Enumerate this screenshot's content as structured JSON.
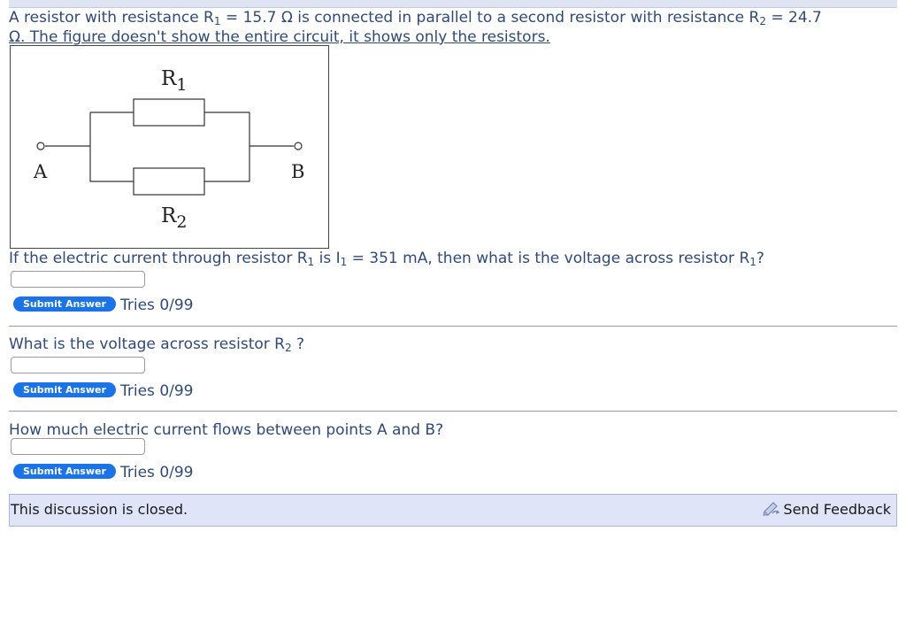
{
  "intro": {
    "p1": "A resistor with resistance R",
    "s1": "1",
    "p2": " = 15.7 Ω is connected in parallel to a second resistor with resistance R",
    "s2": "2",
    "p3": " = 24.7",
    "p4": "Ω. The figure doesn't show the entire circuit, it shows only the resistors."
  },
  "figure": {
    "label_r1": "R",
    "label_r1_sub": "1",
    "label_r2": "R",
    "label_r2_sub": "2",
    "label_a": "A",
    "label_b": "B"
  },
  "q1": {
    "p1": "If the electric current through resistor R",
    "s1": "1",
    "p2": " is I",
    "s2": "1",
    "p3": " = 351 mA, then what is the voltage across resistor R",
    "s3": "1",
    "p4": "?",
    "input_value": "",
    "submit_label": "Submit Answer",
    "tries": "Tries 0/99"
  },
  "q2": {
    "p1": "What is the voltage across resistor R",
    "s1": "2",
    "p2": " ?",
    "input_value": "",
    "submit_label": "Submit Answer",
    "tries": "Tries 0/99"
  },
  "q3": {
    "text": "How much electric current flows between points A and B?",
    "input_value": "",
    "submit_label": "Submit Answer",
    "tries": "Tries 0/99"
  },
  "footer": {
    "closed_text": "This discussion is closed.",
    "feedback_label": "Send Feedback",
    "feedback_icon": "feedback-pencil-icon"
  },
  "colors": {
    "text_blue": "#2f4a7a",
    "button_blue": "#1a73e8",
    "closed_bar_bg": "#dfe4f9",
    "closed_bar_border": "#a7b4dc"
  }
}
